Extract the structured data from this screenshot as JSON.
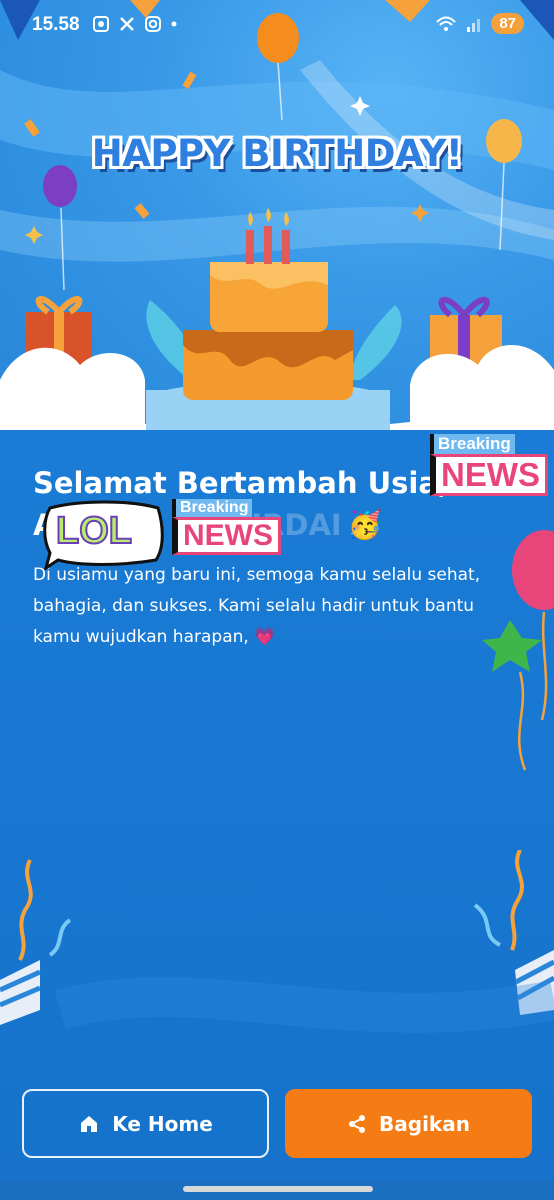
{
  "status_bar": {
    "time": "15.58",
    "battery": "87"
  },
  "hero": {
    "title": "HAPPY BIRTHDAY!"
  },
  "greeting": {
    "title_line1": "Selamat Bertambah Usia,",
    "title_line2_partial": "A",
    "name_obscured": "FIRDAI",
    "emoji": "🥳",
    "body": "Di usiamu yang baru ini, semoga kamu selalu sehat, bahagia, dan sukses. Kami selalu hadir untuk bantu kamu wujudkan harapan, 💗"
  },
  "stickers": {
    "breaking_label": "Breaking",
    "news_label": "NEWS",
    "lol_label": "LOL"
  },
  "buttons": {
    "home_label": "Ke Home",
    "share_label": "Bagikan"
  },
  "colors": {
    "background": "#1a7bd6",
    "share_button": "#f57c14",
    "title_blue": "#2f7fe0"
  }
}
